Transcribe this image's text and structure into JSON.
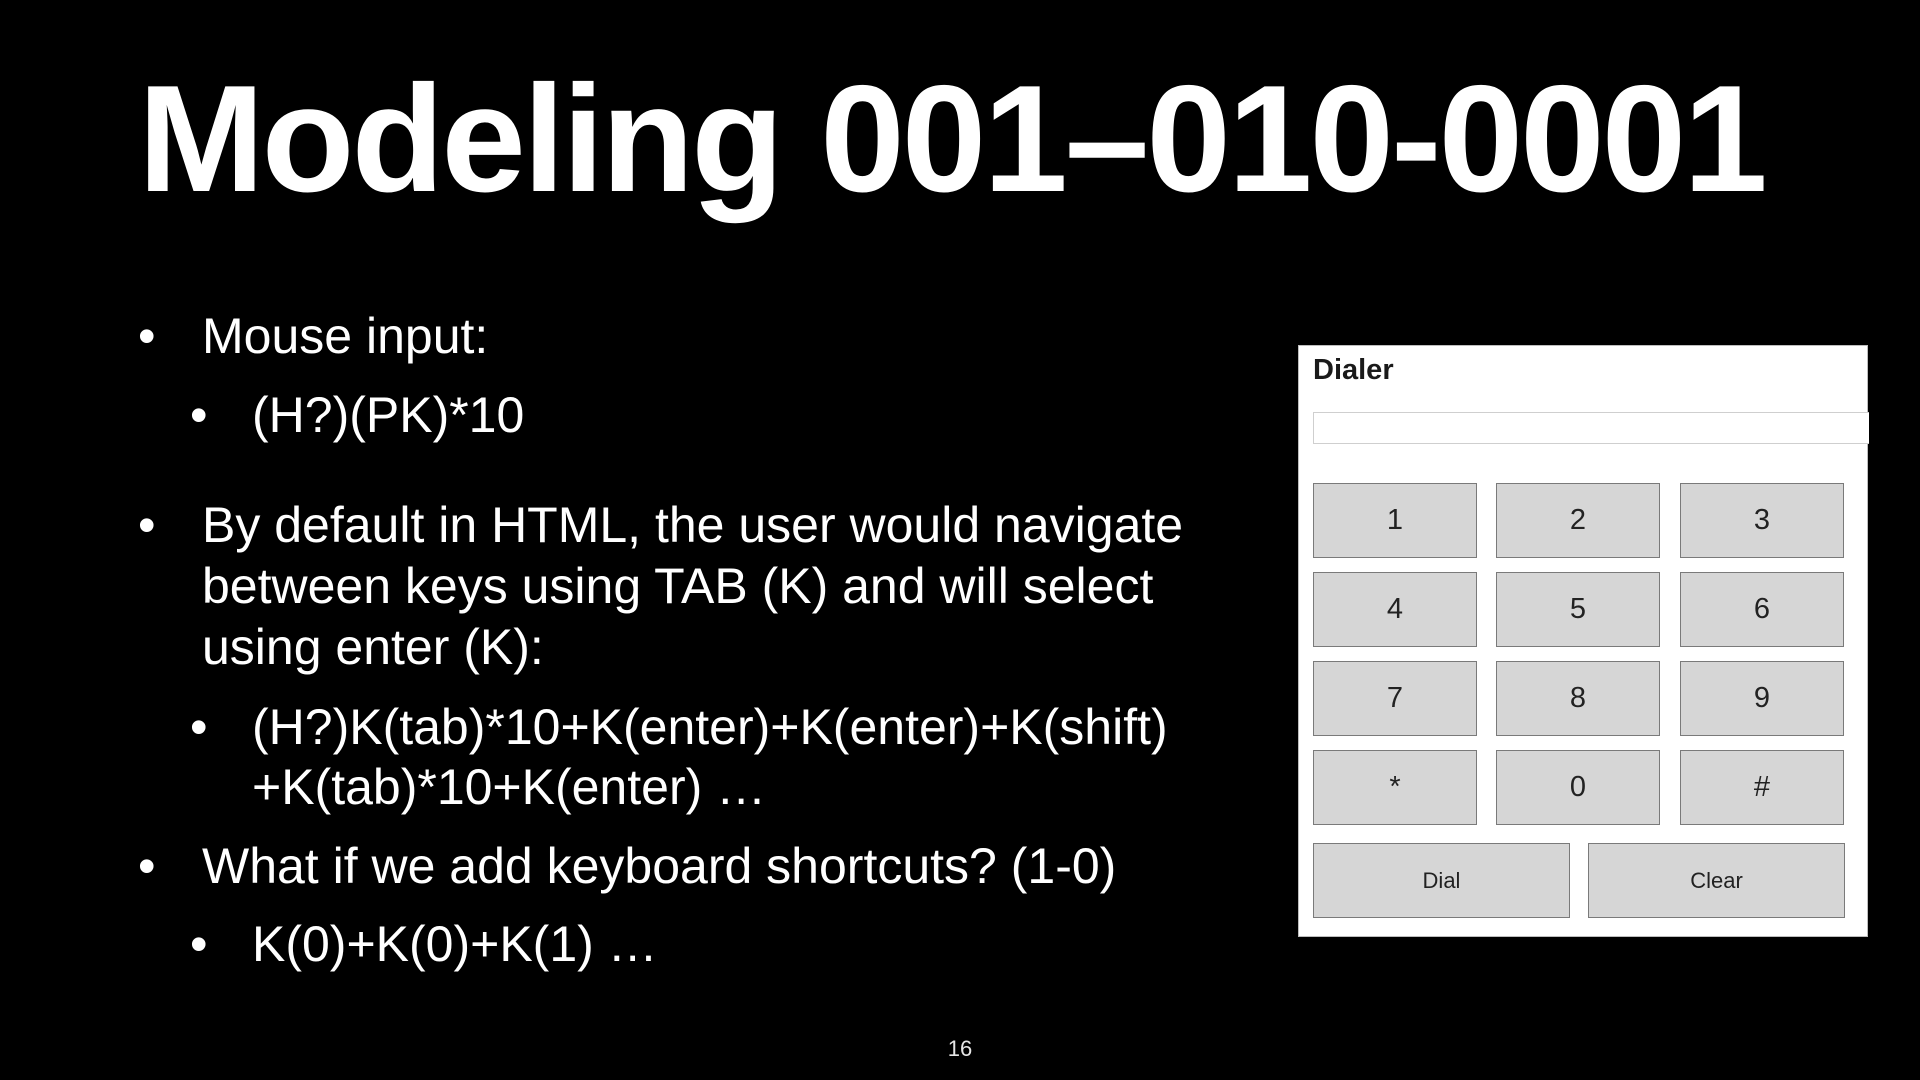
{
  "slide": {
    "title": "Modeling 001–010-0001",
    "page_number": "16"
  },
  "bullets": {
    "marker": "•",
    "mouse_input": "Mouse input:",
    "mouse_seq": "(H?)(PK)*10",
    "default_line1": "By default in HTML, the user would navigate",
    "default_line2": "between keys using TAB (K) and will select",
    "default_line3": "using enter (K):",
    "tab_seq_line1": "(H?)K(tab)*10+K(enter)+K(enter)+K(shift)",
    "tab_seq_line2": "+K(tab)*10+K(enter) …",
    "shortcuts": "What if we add keyboard shortcuts? (1-0)",
    "shortcut_seq": "K(0)+K(0)+K(1) …"
  },
  "dialer": {
    "title": "Dialer",
    "input_value": "",
    "keys": [
      "1",
      "2",
      "3",
      "4",
      "5",
      "6",
      "7",
      "8",
      "9",
      "*",
      "0",
      "#"
    ],
    "dial_label": "Dial",
    "clear_label": "Clear"
  }
}
